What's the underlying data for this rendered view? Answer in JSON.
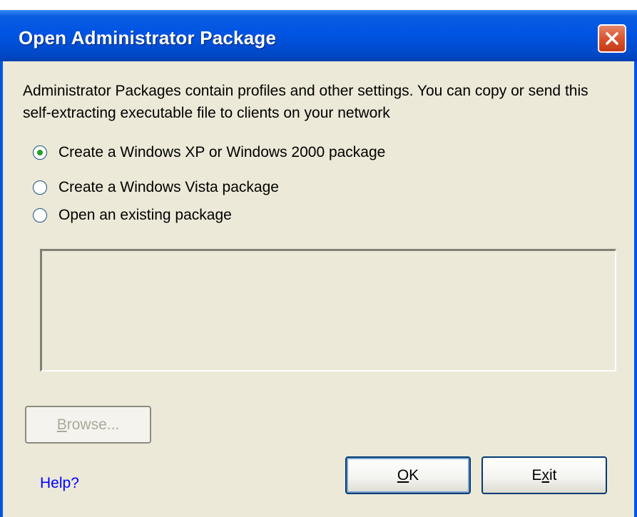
{
  "window": {
    "title": "Open Administrator Package",
    "colors": {
      "titlebar": "#0054e3",
      "close_button": "#d9542f",
      "dialog_bg": "#ece9d8",
      "link": "#0000ff"
    }
  },
  "description": "Administrator Packages contain profiles and other settings. You can copy or send this self-extracting executable file to clients on your network",
  "options": [
    {
      "label": "Create a Windows XP or Windows 2000 package",
      "selected": true
    },
    {
      "label": "Create a Windows Vista package",
      "selected": false
    },
    {
      "label": "Open an existing package",
      "selected": false
    }
  ],
  "path_field": {
    "value": ""
  },
  "buttons": {
    "browse": {
      "label_pre": "",
      "mnemonic": "B",
      "label_post": "rowse...",
      "enabled": false
    },
    "ok": {
      "label_pre": "",
      "mnemonic": "O",
      "label_post": "K"
    },
    "exit": {
      "label_pre": "E",
      "mnemonic": "x",
      "label_post": "it"
    }
  },
  "help_link": "Help?",
  "icons": {
    "close": "close-icon",
    "radio": "radio-icon"
  }
}
